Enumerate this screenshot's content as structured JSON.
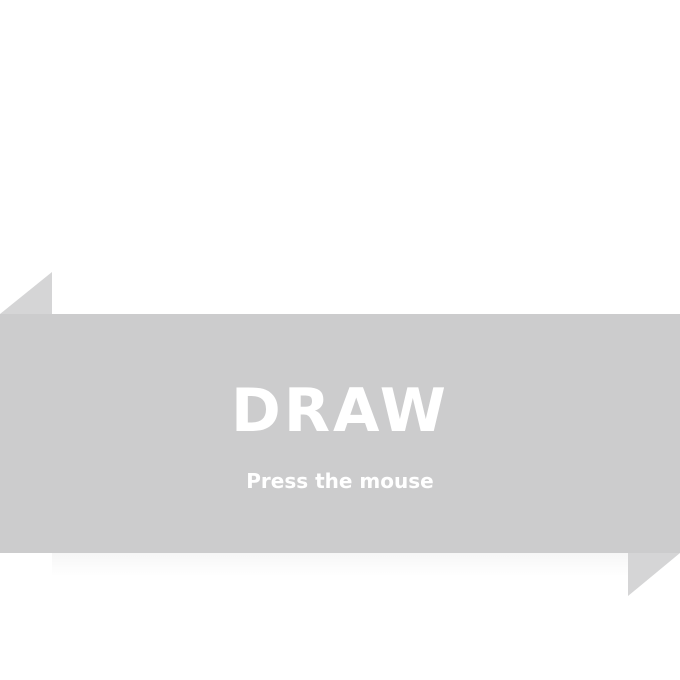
{
  "banner": {
    "title": "DRAW",
    "subtitle": "Press the mouse"
  },
  "colors": {
    "background": "#ffffff",
    "banner": "#cccccd",
    "fold": "#d5d5d6",
    "text": "#ffffff"
  }
}
